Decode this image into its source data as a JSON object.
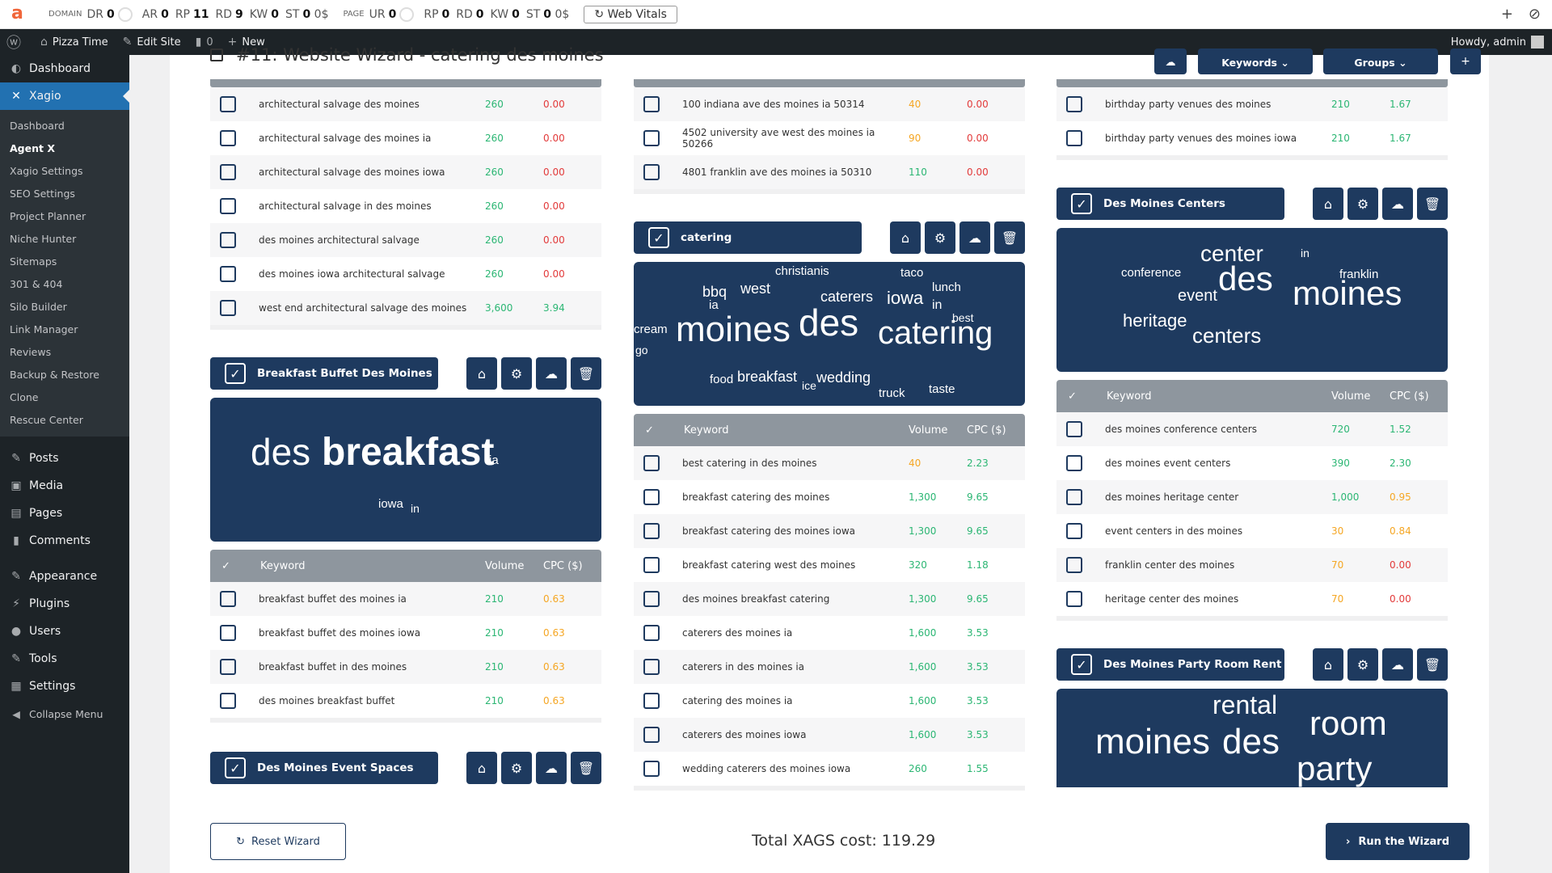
{
  "ext": {
    "domain_label": "DOMAIN",
    "page_label": "PAGE",
    "dr": "DR",
    "dr_v": "0",
    "ar": "AR",
    "ar_v": "0",
    "rp": "RP",
    "rp_v": "11",
    "rd": "RD",
    "rd_v": "9",
    "kw": "KW",
    "kw_v": "0",
    "st": "ST",
    "st_v": "0",
    "st_u": "0$",
    "ur": "UR",
    "ur_v": "0",
    "prp": "RP",
    "prp_v": "0",
    "prd": "RD",
    "prd_v": "0",
    "pkw": "KW",
    "pkw_v": "0",
    "pst": "ST",
    "pst_v": "0",
    "pst_u": "0$",
    "web_vitals": "Web Vitals"
  },
  "wpbar": {
    "site": "Pizza Time",
    "edit": "Edit Site",
    "comments": "0",
    "new": "New",
    "howdy": "Howdy, admin"
  },
  "sidebar": {
    "dashboard": "Dashboard",
    "xagio": "Xagio",
    "sub": [
      "Dashboard",
      "Agent X",
      "Xagio Settings",
      "SEO Settings",
      "Project Planner",
      "Niche Hunter",
      "Sitemaps",
      "301 & 404",
      "Silo Builder",
      "Link Manager",
      "Reviews",
      "Backup & Restore",
      "Clone",
      "Rescue Center"
    ],
    "posts": "Posts",
    "media": "Media",
    "pages": "Pages",
    "comments": "Comments",
    "appearance": "Appearance",
    "plugins": "Plugins",
    "users": "Users",
    "tools": "Tools",
    "settings": "Settings",
    "collapse": "Collapse Menu"
  },
  "header": {
    "title": "#11: Website Wizard - catering des moines",
    "keywords": "Keywords",
    "groups": "Groups"
  },
  "th": {
    "keyword": "Keyword",
    "volume": "Volume",
    "cpc": "CPC ($)"
  },
  "col1": {
    "top_rows": [
      [
        "architectural salvage des moines",
        "260",
        "0.00"
      ],
      [
        "architectural salvage des moines ia",
        "260",
        "0.00"
      ],
      [
        "architectural salvage des moines iowa",
        "260",
        "0.00"
      ],
      [
        "architectural salvage in des moines",
        "260",
        "0.00"
      ],
      [
        "des moines architectural salvage",
        "260",
        "0.00"
      ],
      [
        "des moines iowa architectural salvage",
        "260",
        "0.00"
      ],
      [
        "west end architectural salvage des moines",
        "3,600",
        "3.94"
      ]
    ],
    "g1_name": "Breakfast Buffet Des Moines",
    "g1_cloud": [
      "des",
      "breakfast",
      "ia",
      "iowa",
      "in"
    ],
    "g1_rows": [
      [
        "breakfast buffet des moines ia",
        "210",
        "0.63"
      ],
      [
        "breakfast buffet des moines iowa",
        "210",
        "0.63"
      ],
      [
        "breakfast buffet in des moines",
        "210",
        "0.63"
      ],
      [
        "des moines breakfast buffet",
        "210",
        "0.63"
      ]
    ],
    "g2_name": "Des Moines Event Spaces"
  },
  "col2": {
    "top_rows": [
      [
        "100 indiana ave des moines ia 50314",
        "40",
        "0.00"
      ],
      [
        "4502 university ave west des moines ia 50266",
        "90",
        "0.00"
      ],
      [
        "4801 franklin ave des moines ia 50310",
        "110",
        "0.00"
      ]
    ],
    "g1_name": "catering",
    "g1_cloud": [
      "christianis",
      "taco",
      "bbq",
      "west",
      "lunch",
      "caterers",
      "iowa",
      "ia",
      "in",
      "best",
      "cream",
      "moines",
      "des",
      "catering",
      "go",
      "food",
      "breakfast",
      "ice",
      "wedding",
      "truck",
      "taste"
    ],
    "g1_rows": [
      [
        "best catering in des moines",
        "40",
        "2.23"
      ],
      [
        "breakfast catering des moines",
        "1,300",
        "9.65"
      ],
      [
        "breakfast catering des moines iowa",
        "1,300",
        "9.65"
      ],
      [
        "breakfast catering west des moines",
        "320",
        "1.18"
      ],
      [
        "des moines breakfast catering",
        "1,300",
        "9.65"
      ],
      [
        "caterers des moines ia",
        "1,600",
        "3.53"
      ],
      [
        "caterers in des moines ia",
        "1,600",
        "3.53"
      ],
      [
        "catering des moines ia",
        "1,600",
        "3.53"
      ],
      [
        "caterers des moines iowa",
        "1,600",
        "3.53"
      ],
      [
        "wedding caterers des moines iowa",
        "260",
        "1.55"
      ]
    ]
  },
  "col3": {
    "top_rows": [
      [
        "birthday party venues des moines",
        "210",
        "1.67"
      ],
      [
        "birthday party venues des moines iowa",
        "210",
        "1.67"
      ]
    ],
    "g1_name": "Des Moines Centers",
    "g1_cloud": [
      "center",
      "in",
      "conference",
      "franklin",
      "des",
      "event",
      "moines",
      "heritage",
      "centers"
    ],
    "g1_rows": [
      [
        "des moines conference centers",
        "720",
        "1.52"
      ],
      [
        "des moines event centers",
        "390",
        "2.30"
      ],
      [
        "des moines heritage center",
        "1,000",
        "0.95"
      ],
      [
        "event centers in des moines",
        "30",
        "0.84"
      ],
      [
        "franklin center des moines",
        "70",
        "0.00"
      ],
      [
        "heritage center des moines",
        "70",
        "0.00"
      ]
    ],
    "g2_name": "Des Moines Party Room Rent",
    "g2_cloud": [
      "rental",
      "room",
      "moines",
      "des",
      "party"
    ]
  },
  "footer": {
    "reset": "Reset Wizard",
    "cost": "Total XAGS cost: 119.29",
    "run": "Run the Wizard"
  },
  "colors": {
    "navy": "#1e3a5f",
    "green": "#2bb673",
    "red": "#e23a3a",
    "orange": "#f5a623"
  }
}
